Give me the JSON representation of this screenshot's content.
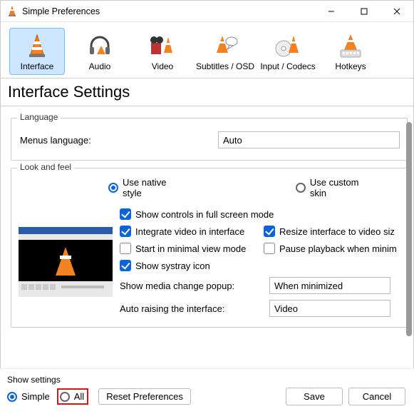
{
  "window": {
    "title": "Simple Preferences"
  },
  "tabs": [
    {
      "id": "interface",
      "label": "Interface",
      "selected": true
    },
    {
      "id": "audio",
      "label": "Audio"
    },
    {
      "id": "video",
      "label": "Video"
    },
    {
      "id": "subs",
      "label": "Subtitles / OSD"
    },
    {
      "id": "input",
      "label": "Input / Codecs"
    },
    {
      "id": "hotkeys",
      "label": "Hotkeys"
    }
  ],
  "heading": "Interface Settings",
  "language": {
    "group_title": "Language",
    "menus_language_label": "Menus language:",
    "menus_language_value": "Auto"
  },
  "lookfeel": {
    "group_title": "Look and feel",
    "style_native": "Use native style",
    "style_custom": "Use custom skin",
    "style_selected": "native",
    "checks": {
      "show_controls": {
        "label": "Show controls in full screen mode",
        "checked": true
      },
      "integrate_video": {
        "label": "Integrate video in interface",
        "checked": true
      },
      "resize_interface": {
        "label": "Resize interface to video siz",
        "checked": true
      },
      "start_minimal": {
        "label": "Start in minimal view mode",
        "checked": false
      },
      "pause_minim": {
        "label": "Pause playback when minim",
        "checked": false
      },
      "systray": {
        "label": "Show systray icon",
        "checked": true
      }
    },
    "media_change_label": "Show media change popup:",
    "media_change_value": "When minimized",
    "auto_raising_label": "Auto raising the interface:",
    "auto_raising_value": "Video"
  },
  "bottom": {
    "show_settings_label": "Show settings",
    "simple_label": "Simple",
    "all_label": "All",
    "selected": "simple",
    "reset_label": "Reset Preferences",
    "save_label": "Save",
    "cancel_label": "Cancel"
  }
}
